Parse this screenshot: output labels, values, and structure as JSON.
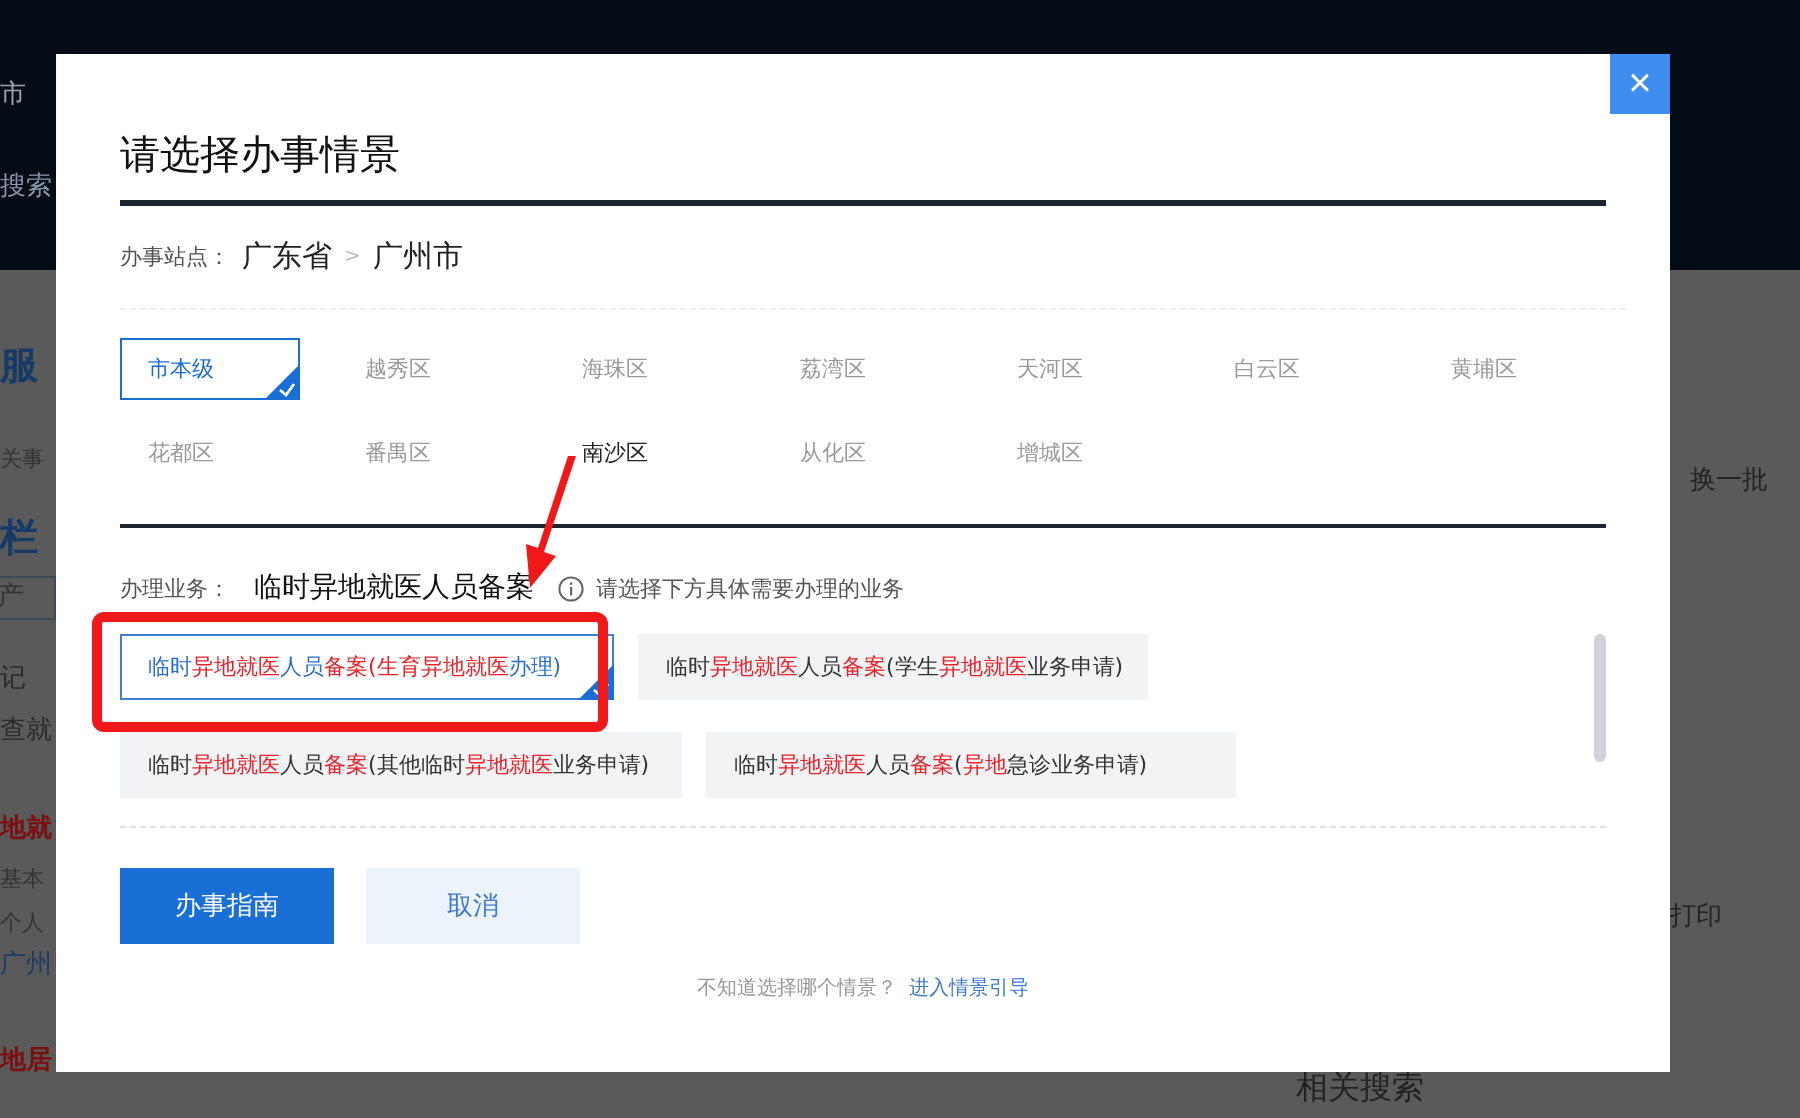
{
  "background": {
    "left_fragments": [
      {
        "text": "市",
        "kind": "plain"
      },
      {
        "text": "搜索",
        "kind": "light"
      },
      {
        "text": "服",
        "kind": "heading"
      },
      {
        "text": "关事",
        "kind": "small"
      },
      {
        "text": "栏",
        "kind": "heading"
      },
      {
        "text": "产",
        "kind": "tab"
      },
      {
        "text": "记",
        "kind": "plain"
      },
      {
        "text": "查就",
        "kind": "plain"
      },
      {
        "text": "地就",
        "kind": "red"
      },
      {
        "text": "基本",
        "kind": "small"
      },
      {
        "text": "个人",
        "kind": "small"
      },
      {
        "text": "广州",
        "kind": "link"
      },
      {
        "text": "地居",
        "kind": "red"
      }
    ],
    "right_fragments": [
      {
        "text": "换一批"
      },
      {
        "text": "打印"
      }
    ],
    "related_title": "相关搜索"
  },
  "dialog": {
    "title": "请选择办事情景",
    "close": "×",
    "site": {
      "label": "办事站点：",
      "province": "广东省",
      "separator": ">",
      "city": "广州市"
    },
    "districts": [
      {
        "name": "市本级",
        "selected": true,
        "hovered": false
      },
      {
        "name": "越秀区",
        "selected": false,
        "hovered": false
      },
      {
        "name": "海珠区",
        "selected": false,
        "hovered": false
      },
      {
        "name": "荔湾区",
        "selected": false,
        "hovered": false
      },
      {
        "name": "天河区",
        "selected": false,
        "hovered": false
      },
      {
        "name": "白云区",
        "selected": false,
        "hovered": false
      },
      {
        "name": "黄埔区",
        "selected": false,
        "hovered": false
      },
      {
        "name": "花都区",
        "selected": false,
        "hovered": false
      },
      {
        "name": "番禺区",
        "selected": false,
        "hovered": false
      },
      {
        "name": "南沙区",
        "selected": false,
        "hovered": true
      },
      {
        "name": "从化区",
        "selected": false,
        "hovered": false
      },
      {
        "name": "增城区",
        "selected": false,
        "hovered": false
      }
    ],
    "business": {
      "label": "办理业务：",
      "value": "临时异地就医人员备案",
      "hint": "请选择下方具体需要办理的业务"
    },
    "options": [
      {
        "selected": true,
        "segments": [
          {
            "text": "临时",
            "highlight": false
          },
          {
            "text": "异地就医",
            "highlight": true
          },
          {
            "text": "人员",
            "highlight": false
          },
          {
            "text": "备案",
            "highlight": true
          },
          {
            "text": "(生育异地就医",
            "highlight": true
          },
          {
            "text": "办理)",
            "highlight": false
          }
        ]
      },
      {
        "selected": false,
        "segments": [
          {
            "text": "临时",
            "highlight": false
          },
          {
            "text": "异地就医",
            "highlight": true
          },
          {
            "text": "人员",
            "highlight": false
          },
          {
            "text": "备案",
            "highlight": true
          },
          {
            "text": "(学生",
            "highlight": false
          },
          {
            "text": "异地就医",
            "highlight": true
          },
          {
            "text": "业务申请)",
            "highlight": false
          }
        ]
      },
      {
        "selected": false,
        "segments": [
          {
            "text": "临时",
            "highlight": false
          },
          {
            "text": "异地就医",
            "highlight": true
          },
          {
            "text": "人员",
            "highlight": false
          },
          {
            "text": "备案",
            "highlight": true
          },
          {
            "text": "(其他临时",
            "highlight": false
          },
          {
            "text": "异地就医",
            "highlight": true
          },
          {
            "text": "业务申请)",
            "highlight": false
          }
        ]
      },
      {
        "selected": false,
        "segments": [
          {
            "text": "临时",
            "highlight": false
          },
          {
            "text": "异地就医",
            "highlight": true
          },
          {
            "text": "人员",
            "highlight": false
          },
          {
            "text": "备案",
            "highlight": true
          },
          {
            "text": "(",
            "highlight": false
          },
          {
            "text": "异地",
            "highlight": true
          },
          {
            "text": "急诊业务申请)",
            "highlight": false
          }
        ]
      }
    ],
    "buttons": [
      {
        "label": "办事指南",
        "kind": "primary"
      },
      {
        "label": "取消",
        "kind": "secondary"
      }
    ],
    "footer": {
      "text": "不知道选择哪个情景？",
      "link": "进入情景引导"
    }
  },
  "annotation": {
    "frame": true,
    "arrow": true
  }
}
